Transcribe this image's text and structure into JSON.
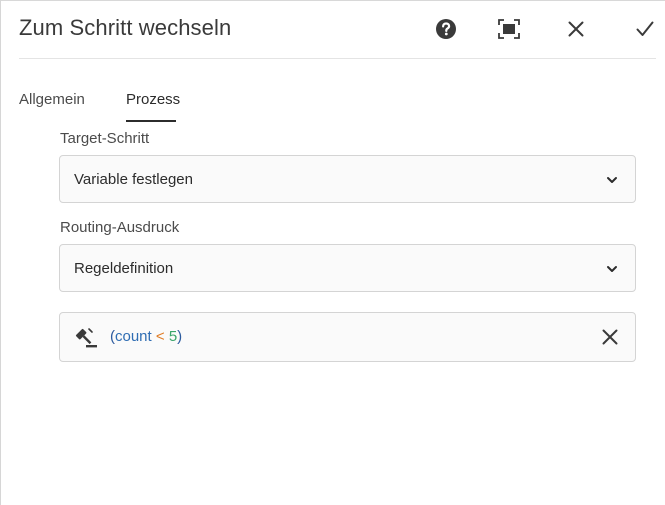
{
  "dialog": {
    "title": "Zum Schritt wechseln",
    "toolbar": {
      "help_icon": "help-circle-icon",
      "fullscreen_icon": "fullscreen-icon",
      "close_icon": "close-icon",
      "done_icon": "checkmark-icon"
    }
  },
  "tabs": [
    {
      "label": "Allgemein",
      "selected": false
    },
    {
      "label": "Prozess",
      "selected": true
    }
  ],
  "fields": {
    "target_step": {
      "label": "Target-Schritt",
      "value": "Variable festlegen"
    },
    "routing_expression": {
      "label": "Routing-Ausdruck",
      "value": "Regeldefinition"
    }
  },
  "rule": {
    "icon": "gavel-icon",
    "open_paren": "(",
    "variable": "count",
    "operator": "<",
    "value": "5",
    "close_paren": ")"
  },
  "colors": {
    "variable": "#2f6db3",
    "operator": "#e07b23",
    "number": "#3aa56b"
  }
}
